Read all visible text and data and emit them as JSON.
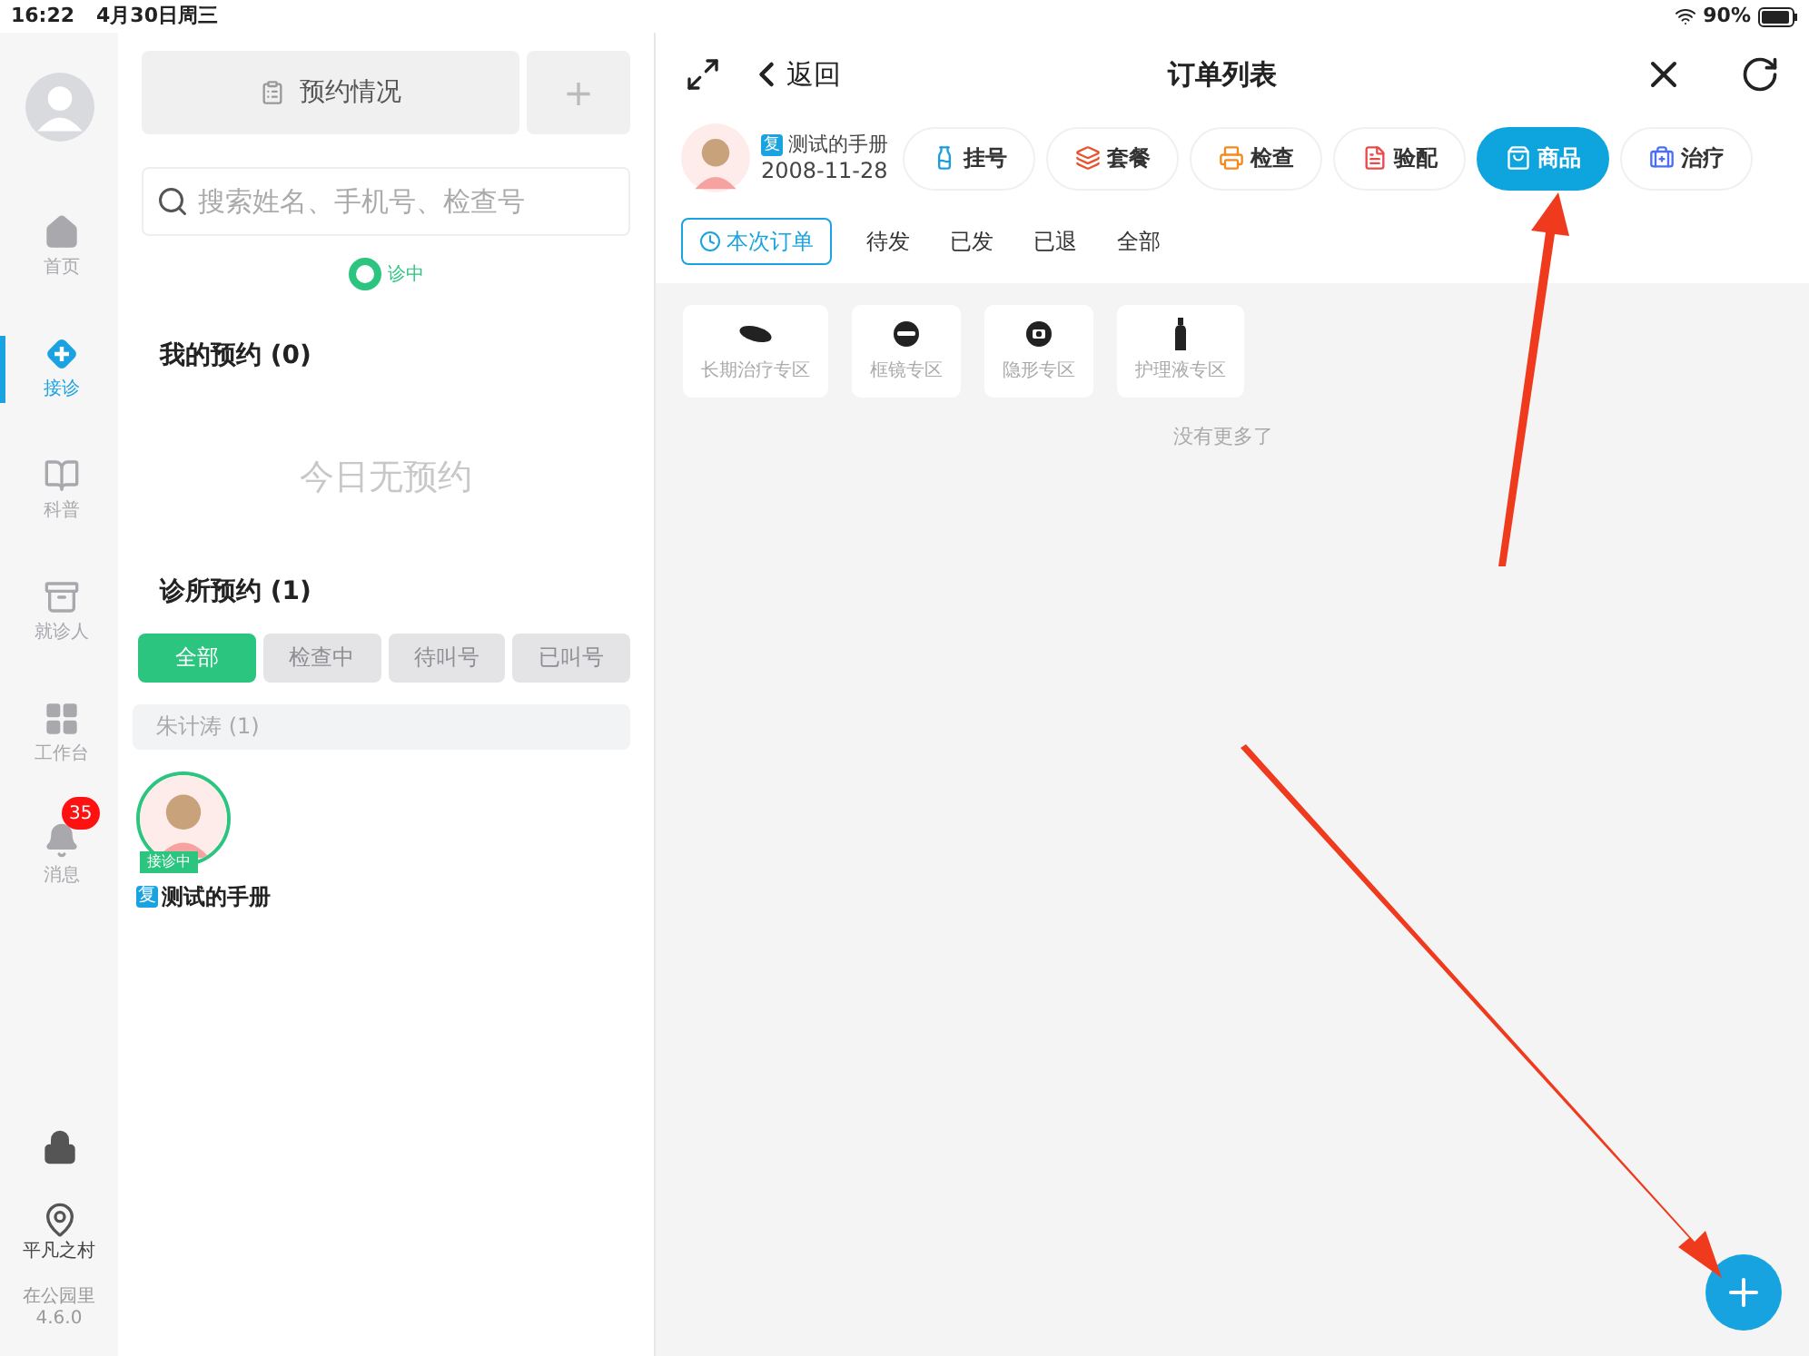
{
  "status_bar": {
    "time": "16:22",
    "date": "4月30日周三",
    "battery": "90%"
  },
  "nav": {
    "items": [
      {
        "label": "首页",
        "selected": false
      },
      {
        "label": "接诊",
        "selected": true
      },
      {
        "label": "科普",
        "selected": false
      },
      {
        "label": "就诊人",
        "selected": false
      },
      {
        "label": "工作台",
        "selected": false
      },
      {
        "label": "消息",
        "selected": false,
        "badge": "35"
      }
    ],
    "location": "平凡之村",
    "footer": [
      "在公园里",
      "4.6.0"
    ]
  },
  "appointments": {
    "overview_button": "预约情况",
    "add_button": "+",
    "search": {
      "placeholder": "搜索姓名、手机号、检查号"
    },
    "status": "诊中",
    "my": {
      "title": "我的预约 (0)",
      "empty": "今日无预约"
    },
    "clinic": {
      "title": "诊所预约 (1)",
      "filters": [
        {
          "label": "全部",
          "selected": true
        },
        {
          "label": "检查中",
          "selected": false
        },
        {
          "label": "待叫号",
          "selected": false
        },
        {
          "label": "已叫号",
          "selected": false
        }
      ],
      "group": "朱计涛 (1)",
      "patients": [
        {
          "name": "测试的手册",
          "tag": "复",
          "status": "接诊中"
        }
      ]
    }
  },
  "order": {
    "back": "返回",
    "title": "订单列表",
    "patient": {
      "tag": "复",
      "name": "测试的手册",
      "dob": "2008-11-28"
    },
    "actions": [
      {
        "label": "挂号",
        "selected": false
      },
      {
        "label": "套餐",
        "selected": false
      },
      {
        "label": "检查",
        "selected": false
      },
      {
        "label": "验配",
        "selected": false
      },
      {
        "label": "商品",
        "selected": true
      },
      {
        "label": "治疗",
        "selected": false
      }
    ],
    "tabs": [
      {
        "label": "本次订单",
        "selected": true
      },
      {
        "label": "待发",
        "selected": false
      },
      {
        "label": "已发",
        "selected": false
      },
      {
        "label": "已退",
        "selected": false
      },
      {
        "label": "全部",
        "selected": false
      }
    ],
    "categories": [
      {
        "label": "长期治疗专区"
      },
      {
        "label": "框镜专区"
      },
      {
        "label": "隐形专区"
      },
      {
        "label": "护理液专区"
      }
    ],
    "end_note": "没有更多了"
  }
}
